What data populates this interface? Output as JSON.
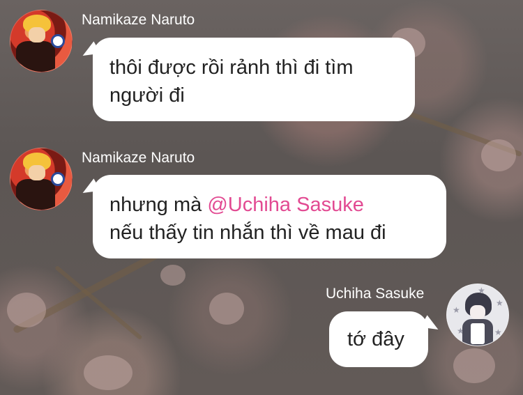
{
  "messages": [
    {
      "sender": "Namikaze Naruto",
      "avatar_icon": "naruto-avatar",
      "lines": [
        "thôi được rồi rảnh thì đi tìm",
        "người đi"
      ]
    },
    {
      "sender": "Namikaze Naruto",
      "avatar_icon": "naruto-avatar",
      "line1_prefix": "nhưng mà ",
      "mention": "@Uchiha Sasuke",
      "line2": "nếu thấy tin nhắn thì về mau đi"
    },
    {
      "sender": "Uchiha Sasuke",
      "avatar_icon": "sasuke-avatar",
      "lines": [
        "tớ đây"
      ]
    }
  ],
  "colors": {
    "mention": "#e24a92",
    "bubble": "#ffffff",
    "name_text": "#ffffff",
    "message_text": "#222222"
  }
}
